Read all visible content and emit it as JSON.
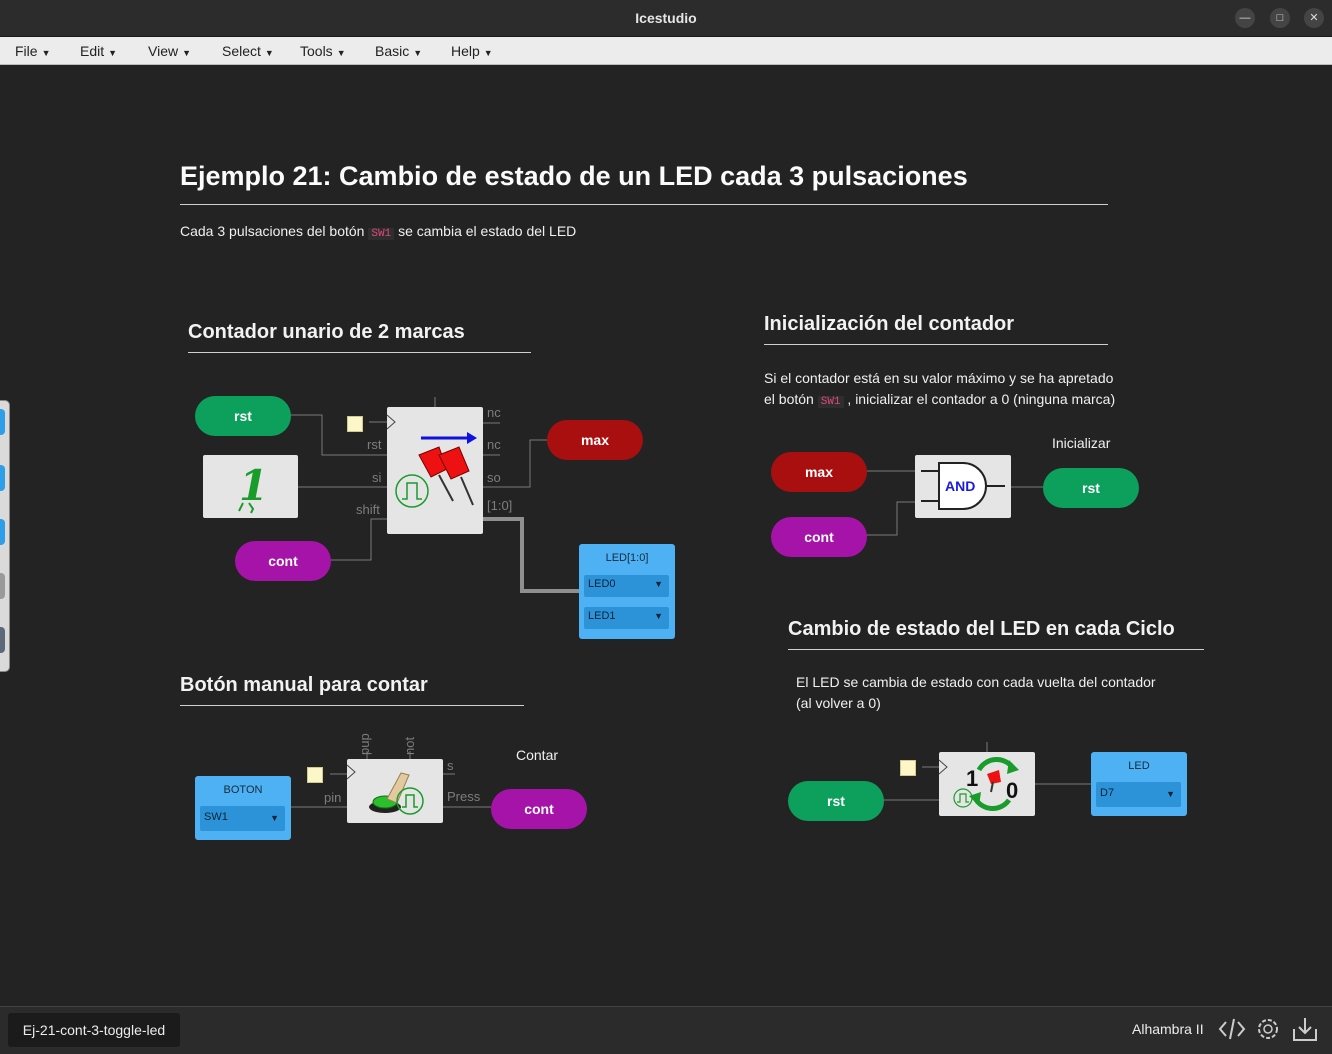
{
  "window": {
    "title": "Icestudio"
  },
  "menu": [
    "File",
    "Edit",
    "View",
    "Select",
    "Tools",
    "Basic",
    "Help"
  ],
  "heading": "Ejemplo 21: Cambio de estado de un LED cada 3 pulsaciones",
  "intro": {
    "before": "Cada 3 pulsaciones del botón",
    "code": "SW1",
    "after": "se cambia el estado del LED"
  },
  "sections": {
    "counter": {
      "title": "Contador unario de 2 marcas"
    },
    "init": {
      "title": "Inicialización del contador",
      "line1": "Si el contador está en su valor máximo y se ha apretado",
      "line2_before": "el botón",
      "line2_code": "SW1",
      "line2_after": ", inicializar el contador a 0 (ninguna marca)"
    },
    "button": {
      "title": "Botón manual para contar"
    },
    "toggle": {
      "title": "Cambio de estado del LED en cada Ciclo",
      "line1": "El LED se cambia de estado con cada vuelta del contador",
      "line2": "(al volver a 0)"
    }
  },
  "counter_block": {
    "labels": {
      "rst_in": "rst",
      "si": "si",
      "shift": "shift",
      "nc1": "nc",
      "nc2": "nc",
      "so": "so",
      "bus": "[1:0]"
    },
    "const_value": "1",
    "inputs": {
      "rst": "rst",
      "cont": "cont"
    },
    "outputs": {
      "max": "max"
    },
    "led_block": {
      "title": "LED[1:0]",
      "pins": [
        "LED0",
        "LED1"
      ]
    }
  },
  "and_block": {
    "inputs": {
      "max": "max",
      "cont": "cont"
    },
    "gate_label": "AND",
    "output": "rst",
    "output_label": "Inicializar"
  },
  "button_block": {
    "io_title": "BOTON",
    "io_value": "SW1",
    "pin_label": "pin",
    "pup_label": "pup",
    "not_label": "not",
    "s_label": "s",
    "press_label": "Press",
    "output": "cont",
    "output_label": "Contar"
  },
  "toggle_block": {
    "input": "rst",
    "digit_one": "1",
    "digit_zero": "0",
    "led_title": "LED",
    "led_value": "D7"
  },
  "status": {
    "tab": "Ej-21-cont-3-toggle-led",
    "board": "Alhambra II"
  }
}
